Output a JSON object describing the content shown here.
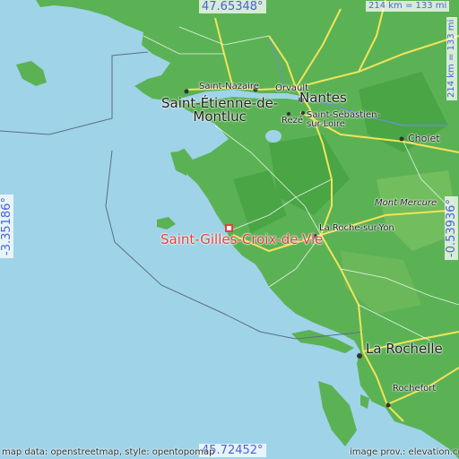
{
  "coords": {
    "top_lat": "47.65348°",
    "bottom_lat": "45.72452°",
    "left_lon": "-3.35186°",
    "right_lon": "-0.53936°"
  },
  "scale": {
    "horizontal": "214 km = 133 mi",
    "vertical": "214 km = 133 mi"
  },
  "target_city": "Saint-Gilles-Croix-de-Vie",
  "cities": {
    "saint_nazaire": "Saint-Nazaire",
    "orvault": "Orvault",
    "nantes": "Nantes",
    "saint_etienne": "Saint-Étienne-de-\nMontluc",
    "reze": "Rezé",
    "saint_sebastien": "Saint-Sébastien-\nsur-Loire",
    "cholet": "Cholet",
    "mont_mercure": "Mont Mercure",
    "la_roche": "La Roche-sur-Yon",
    "la_rochelle": "La Rochelle",
    "rochefort": "Rochefort"
  },
  "credits": {
    "left": "map data: openstreetmap, style: opentopomap",
    "right": "image prov.: elevation.city"
  },
  "colors": {
    "sea": "#9fd3e8",
    "land": "#5bb255",
    "land_dark": "#3f9a3c",
    "target": "#e0403a",
    "coord_text": "#4a62d6",
    "road": "#f2e35a"
  }
}
